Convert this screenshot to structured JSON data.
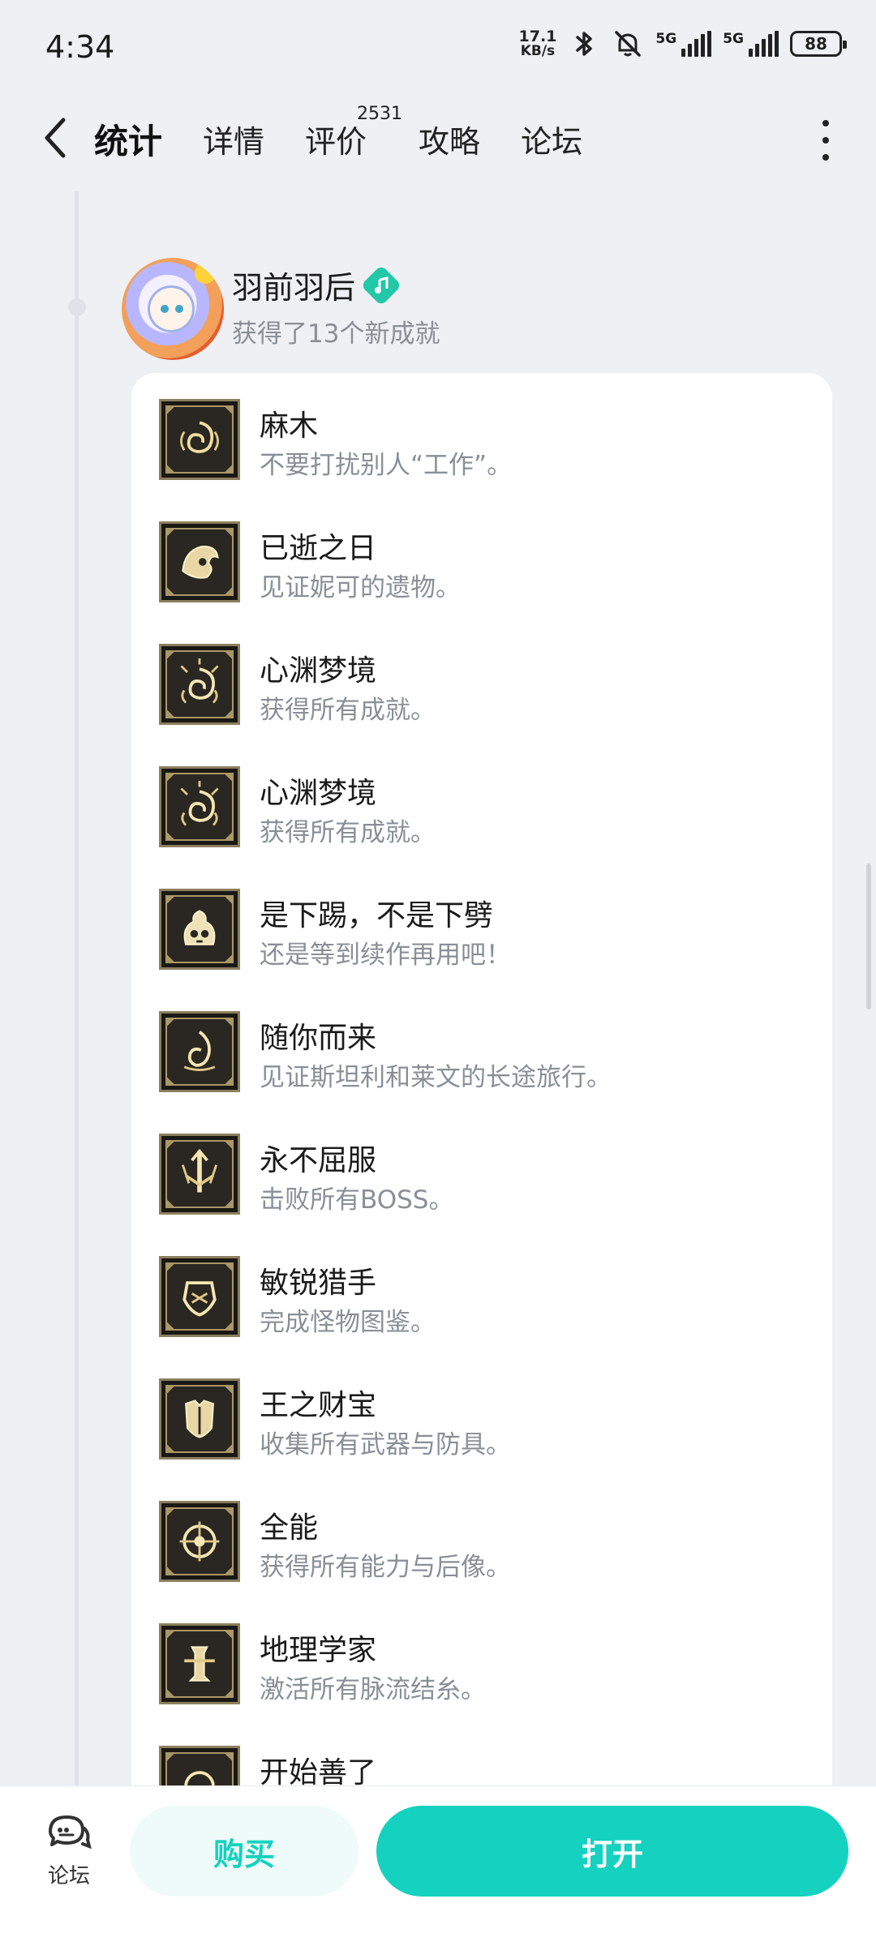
{
  "status_bar": {
    "time": "4:34",
    "net_speed_value": "17.1",
    "net_speed_unit": "KB/s",
    "signal1_label": "5G",
    "signal2_label": "5G",
    "battery": "88"
  },
  "nav": {
    "tabs": [
      {
        "label": "统计",
        "active": true
      },
      {
        "label": "详情"
      },
      {
        "label": "评价",
        "count": "2531"
      },
      {
        "label": "攻略"
      },
      {
        "label": "论坛"
      }
    ]
  },
  "post": {
    "username": "羽前羽后",
    "summary": "获得了13个新成就"
  },
  "achievements": [
    {
      "title": "麻木",
      "desc": "不要打扰别人“工作”。",
      "icon": "swirl-emblem-icon"
    },
    {
      "title": "已逝之日",
      "desc": "见证妮可的遗物。",
      "icon": "relic-emblem-icon"
    },
    {
      "title": "心渊梦境",
      "desc": "获得所有成就。",
      "icon": "spiral-emblem-icon"
    },
    {
      "title": "心渊梦境",
      "desc": "获得所有成就。",
      "icon": "spiral-emblem-icon"
    },
    {
      "title": "是下踢，不是下劈",
      "desc": "还是等到续作再用吧！",
      "icon": "skull-pot-emblem-icon"
    },
    {
      "title": "随你而来",
      "desc": "见证斯坦利和莱文的长途旅行。",
      "icon": "spiral-flame-emblem-icon"
    },
    {
      "title": "永不屈服",
      "desc": "击败所有BOSS。",
      "icon": "sword-emblem-icon"
    },
    {
      "title": "敏锐猎手",
      "desc": "完成怪物图鉴。",
      "icon": "shield-emblem-icon"
    },
    {
      "title": "王之财宝",
      "desc": "收集所有武器与防具。",
      "icon": "armor-emblem-icon"
    },
    {
      "title": "全能",
      "desc": "获得所有能力与后像。",
      "icon": "crest-emblem-icon"
    },
    {
      "title": "地理学家",
      "desc": "激活所有脉流结糸。",
      "icon": "pillar-emblem-icon"
    },
    {
      "title": "开始善了",
      "desc": "",
      "icon": "emblem-icon"
    }
  ],
  "bottom_bar": {
    "forum_label": "论坛",
    "buy_label": "购买",
    "open_label": "打开"
  },
  "colors": {
    "accent": "#14d2bf",
    "badge": "#22c8a8",
    "background": "#eef0f3"
  }
}
